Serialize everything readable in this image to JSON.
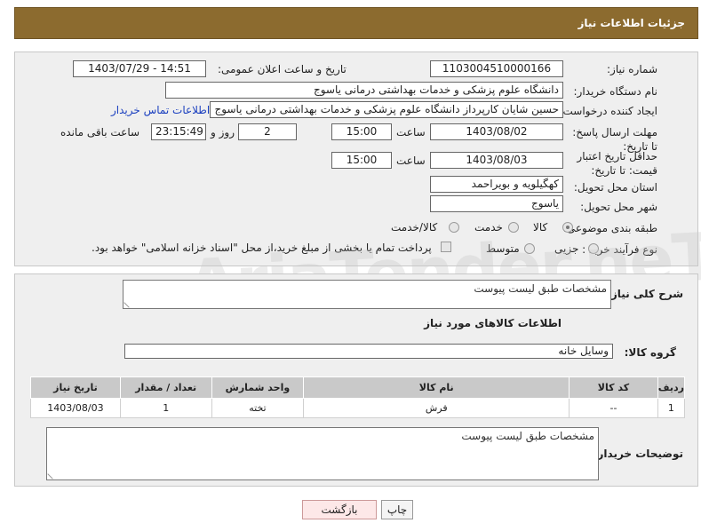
{
  "header": {
    "title": "جزئیات اطلاعات نیاز"
  },
  "fields": {
    "need_number_label": "شماره نیاز:",
    "need_number": "1103004510000166",
    "announce_label": "تاریخ و ساعت اعلان عمومی:",
    "announce_value": "1403/07/29 - 14:51",
    "buyer_org_label": "نام دستگاه خریدار:",
    "buyer_org": "دانشگاه علوم پزشکی و خدمات بهداشتی  درمانی یاسوج",
    "creator_label": "ایجاد کننده درخواست:",
    "creator": "حسین شایان کارپرداز دانشگاه علوم پزشکی و خدمات بهداشتی  درمانی یاسوج",
    "contact_link": "اطلاعات تماس خریدار",
    "reply_deadline_label": "مهلت ارسال پاسخ: تا تاریخ:",
    "reply_date": "1403/08/02",
    "time_label": "ساعت",
    "reply_time": "15:00",
    "days_value": "2",
    "days_label": "روز و",
    "remaining_time": "23:15:49",
    "remaining_label": "ساعت باقی مانده",
    "price_deadline_label": "حداقل تاریخ اعتبار قیمت: تا تاریخ:",
    "price_date": "1403/08/03",
    "price_time": "15:00",
    "province_label": "استان محل تحویل:",
    "province": "کهگیلویه و بویراحمد",
    "city_label": "شهر محل تحویل:",
    "city": "یاسوج",
    "category_label": "طبقه بندی موضوعی:",
    "category_options": [
      "کالا",
      "خدمت",
      "کالا/خدمت"
    ],
    "process_label": "نوع فرآیند خرید :",
    "process_options": [
      "جزیی",
      "متوسط"
    ],
    "treasury_text": "پرداخت تمام یا بخشی از مبلغ خرید،از محل \"اسناد خزانه اسلامی\" خواهد بود."
  },
  "details": {
    "description_label": "شرح کلی نیاز:",
    "description": "مشخصات طبق لیست پیوست",
    "goods_info_title": "اطلاعات کالاهای مورد نیاز",
    "goods_group_label": "گروه کالا:",
    "goods_group": "وسایل خانه",
    "table_headers": [
      "ردیف",
      "کد کالا",
      "نام کالا",
      "واحد شمارش",
      "تعداد / مقدار",
      "تاریخ نیاز"
    ],
    "table_rows": [
      [
        "1",
        "--",
        "فرش",
        "تخته",
        "1",
        "1403/08/03"
      ]
    ],
    "buyer_notes_label": "توضیحات خریدار:",
    "buyer_notes": "مشخصات طبق لیست پیوست"
  },
  "buttons": {
    "print": "چاپ",
    "back": "بازگشت"
  },
  "watermark": "AriaTender.neT"
}
